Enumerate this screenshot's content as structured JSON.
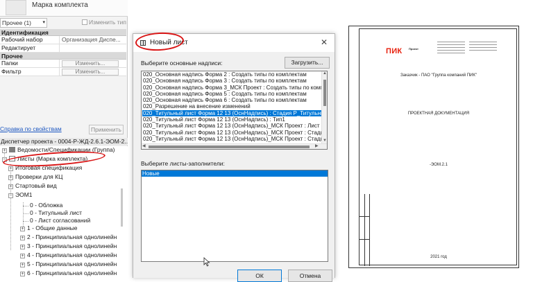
{
  "properties": {
    "type_name": "Марка комплекта",
    "filter_value": "Прочее (1)",
    "edit_type_label": "Изменить тип",
    "groups": [
      {
        "title": "Идентификация",
        "rows": [
          {
            "key": "Рабочий набор",
            "value": "Организация Диспе..."
          },
          {
            "key": "Редактирует",
            "value": ""
          }
        ]
      },
      {
        "title": "Прочее",
        "rows": [
          {
            "key": "Папки",
            "value": "Изменить..."
          },
          {
            "key": "Фильтр",
            "value": "Изменить..."
          }
        ]
      }
    ],
    "help_link": "Справка по свойствам",
    "apply_label": "Применить"
  },
  "project_browser": {
    "title": "Диспетчер проекта - 0004-Р-ЖД-2.6.1-ЭОМ-2...",
    "nodes": [
      {
        "label": "Ведомости/Спецификации (Группа)",
        "toggle": "+"
      },
      {
        "label": "Листы (Марка комплекта)",
        "toggle": "−"
      },
      {
        "label": "Итоговая спецификация",
        "toggle": "+"
      },
      {
        "label": "Проверки для КЦ",
        "toggle": "+"
      },
      {
        "label": "Стартовый вид",
        "toggle": "+"
      },
      {
        "label": "ЭОМ1",
        "toggle": "−"
      },
      {
        "label": "0 - Обложка",
        "toggle": ""
      },
      {
        "label": "0 - Титульный лист",
        "toggle": ""
      },
      {
        "label": "0 - Лист согласований",
        "toggle": ""
      },
      {
        "label": "1 - Общие данные",
        "toggle": "+"
      },
      {
        "label": "2 - Принципиальная однолинейн",
        "toggle": "+"
      },
      {
        "label": "3 - Принципиальная однолинейн",
        "toggle": "+"
      },
      {
        "label": "4 - Принципиальная однолинейн",
        "toggle": "+"
      },
      {
        "label": "5 - Принципиальная однолинейн",
        "toggle": "+"
      },
      {
        "label": "6 - Принципиальная однолинейн",
        "toggle": "+"
      }
    ]
  },
  "dialog": {
    "title": "Новый лист",
    "title_block_label": "Выберите основные надписи:",
    "load_button": "Загрузить...",
    "title_blocks": [
      "020_Основная надпись Форма 2 : Создать типы по комплектам",
      "020_Основная надпись Форма 3 : Создать типы по комплектам",
      "020_Основная надпись Форма 3_МСК Проект : Создать типы по комплект",
      "020_Основная надпись Форма 5 : Создать типы по комплектам",
      "020_Основная надпись Форма 6 : Создать типы по комплектам",
      "020_Разрешение на внесение изменений",
      "020_Титульный лист Форма 12 13 (ОснНадпись) : Стадия Р_Титульный л",
      "020_Титульный лист Форма 12 13 (ОснНадпись) : Тип1",
      "020_Титульный лист Форма 12 13 (ОснНадпись)_МСК Проект : Лист согл",
      "020_Титульный лист Форма 12 13 (ОснНадпись)_МСК Проект : Стадия Р",
      "020_Титульный лист Форма 12 13 (ОснНадпись)_МСК Проект : Стадия Р"
    ],
    "selected_title_block_index": 6,
    "placeholder_label": "Выберите листы-заполнители:",
    "placeholders": [
      "Новые"
    ],
    "ok_label": "ОК",
    "cancel_label": "Отмена"
  },
  "sheet_preview": {
    "logo_text": "ПИК",
    "logo_sub": "Проект",
    "customer": "Заказчик - ПАО \"Группа компаний ПИК\"",
    "doc_title": "ПРОЕКТНАЯ ДОКУМЕНТАЦИЯ",
    "doc_code": "-ЭОМ.2.1",
    "year": "2021 год"
  },
  "colors": {
    "selection": "#0078d7",
    "annotation_red": "#d91515",
    "logo_red": "#e8220f"
  }
}
